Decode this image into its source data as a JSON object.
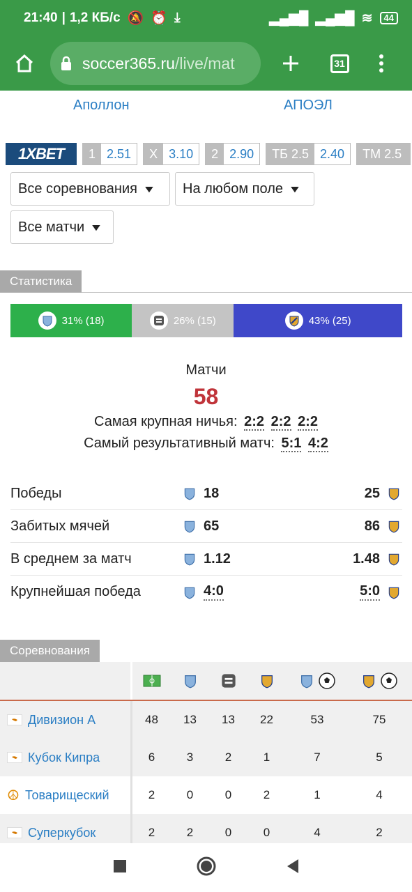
{
  "status": {
    "time": "21:40",
    "speed": "1,2 КБ/с",
    "battery": "44"
  },
  "browser": {
    "url_host": "soccer365.ru",
    "url_path": "/live/mat",
    "tabs_count": "31"
  },
  "teams": {
    "home": "Аполлон",
    "away": "АПОЭЛ"
  },
  "odds": [
    {
      "key": "1",
      "value": "2.51"
    },
    {
      "key": "X",
      "value": "3.10"
    },
    {
      "key": "2",
      "value": "2.90"
    },
    {
      "key": "ТБ 2.5",
      "value": "2.40"
    },
    {
      "key": "ТМ 2.5",
      "value": ""
    }
  ],
  "bookmaker": "1XBET",
  "filters": {
    "competitions": "Все соревнования",
    "field": "На любом поле",
    "matches": "Все матчи"
  },
  "stats_section": "Статистика",
  "pct": {
    "home": "31% (18)",
    "draw": "26% (15)",
    "away": "43% (25)",
    "home_frac": 0.31,
    "draw_frac": 0.26,
    "away_frac": 0.43,
    "home_color": "#2db04b",
    "draw_color": "#c4c4c4",
    "away_color": "#3f48c9"
  },
  "summary": {
    "matches_label": "Матчи",
    "matches_count": "58",
    "biggest_draw_label": "Самая крупная ничья:",
    "biggest_draw_scores": [
      "2:2",
      "2:2",
      "2:2"
    ],
    "top_scoring_label": "Самый результативный матч:",
    "top_scoring_scores": [
      "5:1",
      "4:2"
    ]
  },
  "stats": [
    {
      "label": "Победы",
      "home": "18",
      "away": "25"
    },
    {
      "label": "Забитых мячей",
      "home": "65",
      "away": "86"
    },
    {
      "label": "В среднем за матч",
      "home": "1.12",
      "away": "1.48"
    },
    {
      "label": "Крупнейшая победа",
      "home": "4:0",
      "away": "5:0"
    }
  ],
  "competitions_section": "Соревнования",
  "competitions": [
    {
      "name": "Дивизион А",
      "values": [
        "48",
        "13",
        "13",
        "22",
        "53",
        "75"
      ]
    },
    {
      "name": "Кубок Кипра",
      "values": [
        "6",
        "3",
        "2",
        "1",
        "7",
        "5"
      ]
    },
    {
      "name": "Товарищеский",
      "values": [
        "2",
        "0",
        "0",
        "2",
        "1",
        "4"
      ]
    },
    {
      "name": "Суперкубок",
      "values": [
        "2",
        "2",
        "0",
        "0",
        "4",
        "2"
      ]
    }
  ]
}
